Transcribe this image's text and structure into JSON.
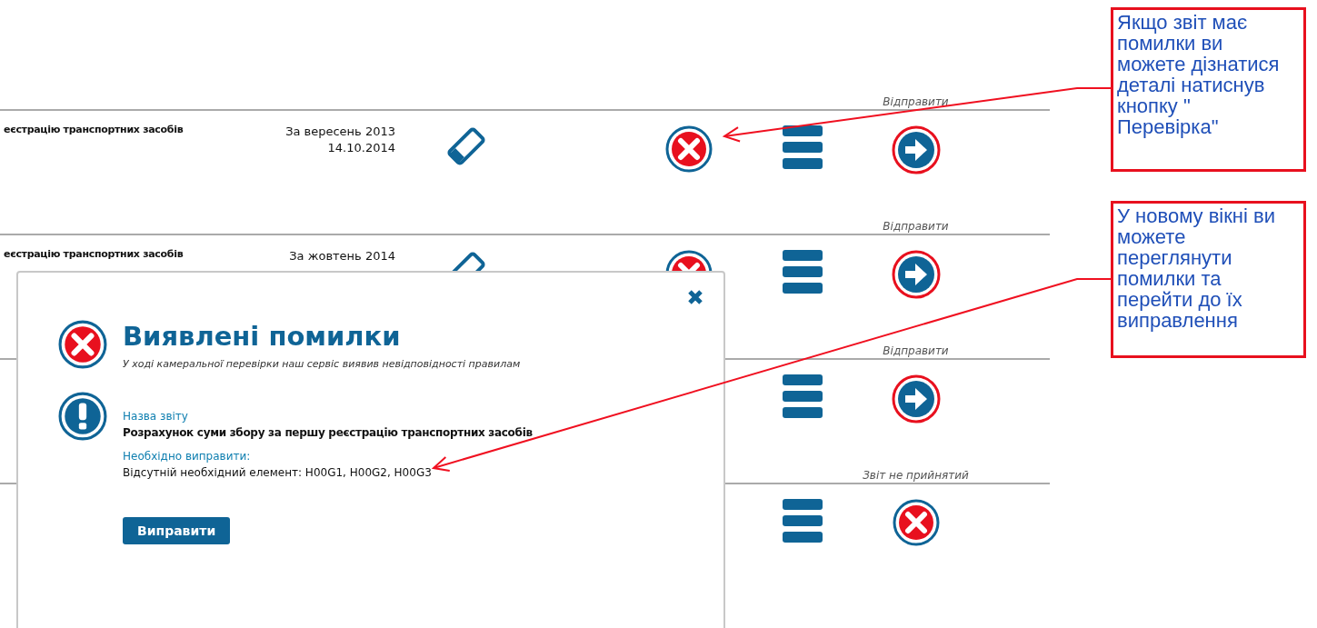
{
  "rows": [
    {
      "status": "Відправити",
      "title": "еєстрацію транспортних засобів",
      "period": "За вересень 2013",
      "date": "14.10.2014",
      "actions": [
        {
          "kind": "edit"
        },
        {
          "kind": "check"
        },
        {
          "kind": "menu"
        },
        {
          "kind": "send"
        }
      ]
    },
    {
      "status": "Відправити",
      "title": "еєстрацію транспортних засобів",
      "period": "За жовтень 2014",
      "actions": [
        {
          "kind": "edit"
        },
        {
          "kind": "check"
        },
        {
          "kind": "menu"
        },
        {
          "kind": "send"
        }
      ]
    },
    {
      "status": "Відправити",
      "actions": [
        {
          "kind": "menu"
        },
        {
          "kind": "send"
        }
      ]
    },
    {
      "status": "Звіт не прийнятий",
      "actions": [
        {
          "kind": "menu"
        },
        {
          "kind": "rejected"
        }
      ]
    }
  ],
  "dialog": {
    "title": "Виявлені помилки",
    "subtitle": "У ході камеральної перевірки наш сервіс виявив невідповідності правилам",
    "fields": [
      {
        "label": "Назва звіту",
        "value": "Розрахунок суми збору за першу реєстрацію транспортних засобів",
        "emphasis": true
      },
      {
        "label": "Необхідно виправити:",
        "value": "Відсутній необхідний елемент: H00G1, H00G2, H00G3",
        "emphasis": false
      }
    ],
    "button": "Виправити"
  },
  "annotations": [
    {
      "text": "Якщо звіт має помилки ви можете дізнатися деталі натиснув кнопку \" Перевірка\""
    },
    {
      "text": "У новому вікні ви можете переглянути помилки та перейти до їх виправлення"
    }
  ]
}
